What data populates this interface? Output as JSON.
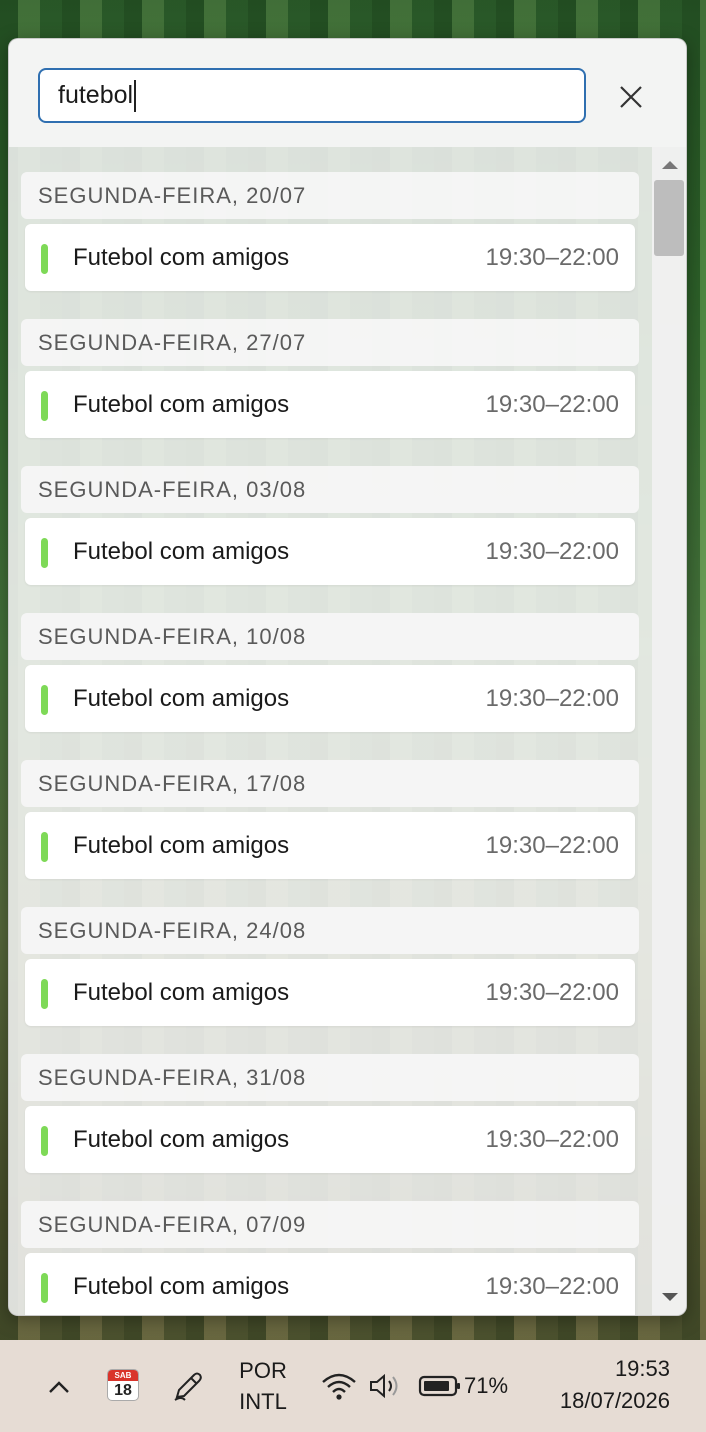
{
  "search": {
    "value": "futebol"
  },
  "results": [
    {
      "day": "SEGUNDA-FEIRA, 20/07",
      "title": "Futebol com amigos",
      "time": "19:30–22:00"
    },
    {
      "day": "SEGUNDA-FEIRA, 27/07",
      "title": "Futebol com amigos",
      "time": "19:30–22:00"
    },
    {
      "day": "SEGUNDA-FEIRA, 03/08",
      "title": "Futebol com amigos",
      "time": "19:30–22:00"
    },
    {
      "day": "SEGUNDA-FEIRA, 10/08",
      "title": "Futebol com amigos",
      "time": "19:30–22:00"
    },
    {
      "day": "SEGUNDA-FEIRA, 17/08",
      "title": "Futebol com amigos",
      "time": "19:30–22:00"
    },
    {
      "day": "SEGUNDA-FEIRA, 24/08",
      "title": "Futebol com amigos",
      "time": "19:30–22:00"
    },
    {
      "day": "SEGUNDA-FEIRA, 31/08",
      "title": "Futebol com amigos",
      "time": "19:30–22:00"
    },
    {
      "day": "SEGUNDA-FEIRA, 07/09",
      "title": "Futebol com amigos",
      "time": "19:30–22:00"
    }
  ],
  "colors": {
    "event_bar": "#7ed957",
    "input_border": "#2f6fb0"
  },
  "taskbar": {
    "calendar_icon_day_abbr": "SAB",
    "calendar_icon_day_num": "18",
    "lang_line1": "POR",
    "lang_line2": "INTL",
    "battery": "71%",
    "time": "19:53",
    "date": "18/07/2026"
  }
}
